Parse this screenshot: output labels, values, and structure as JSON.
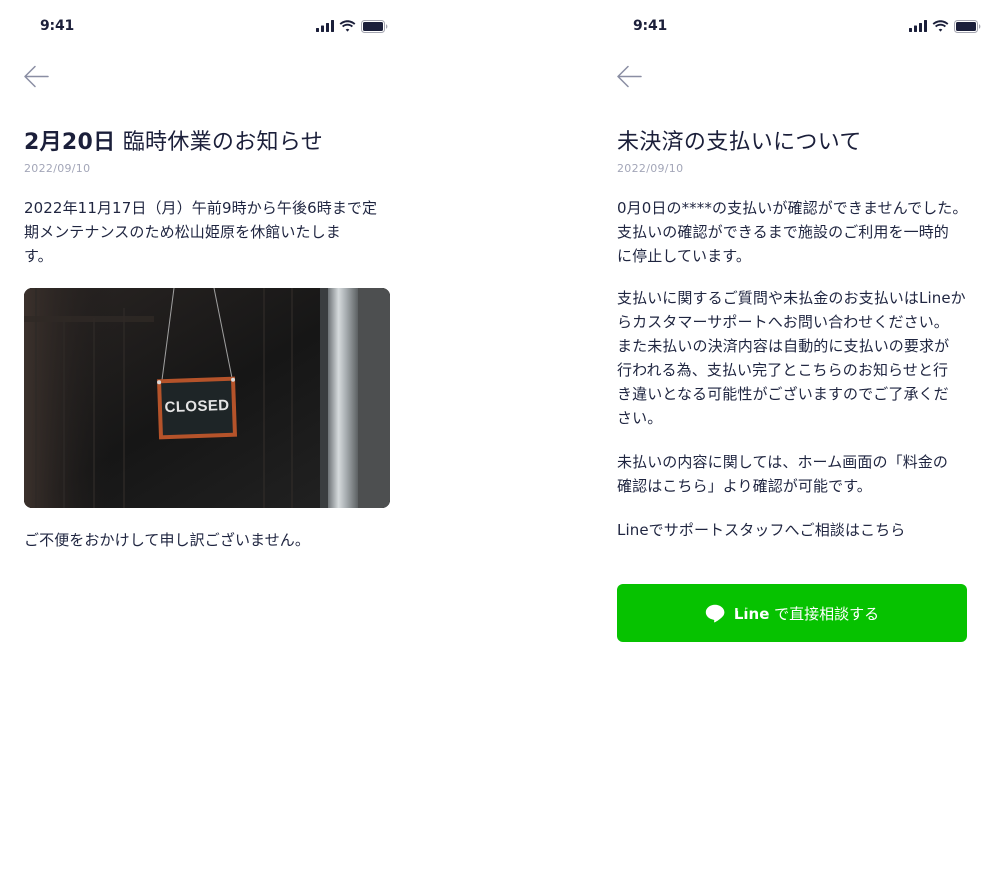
{
  "status_bar": {
    "time": "9:41"
  },
  "notice": {
    "title_num": "2月20日",
    "title_rest": " 臨時休業のお知らせ",
    "date": "2022/09/10",
    "body_lines": [
      "2022年11月17日（月）午前9時から午後6時まで定",
      "期メンテナンスのため松山姫原を休館いたしま",
      "す。"
    ],
    "photo_sign_text": "CLOSED",
    "footer_text": "ご不便をおかけして申し訳ございません。"
  },
  "payment": {
    "title": "未決済の支払いについて",
    "date": "2022/09/10",
    "paragraph1_lines": [
      "0月0日の****の支払いが確認ができませんでした。",
      "支払いの確認ができるまで施設のご利用を一時的",
      "に停止しています。"
    ],
    "paragraph2_lines": [
      "支払いに関するご質問や未払金のお支払いはLineか",
      "らカスタマーサポートへお問い合わせください。",
      "また未払いの決済内容は自動的に支払いの要求が",
      "行われる為、支払い完了とこちらのお知らせと行",
      "き違いとなる可能性がございますのでご了承くだ",
      "さい。"
    ],
    "paragraph3_lines": [
      "未払いの内容に関しては、ホーム画面の「料金の",
      "確認はこちら」より確認が可能です。"
    ],
    "paragraph4": "Lineでサポートスタッフへご相談はこちら",
    "button": {
      "icon_text": "LINE",
      "label_strong": "Line",
      "label_rest": " で直接相談する"
    }
  },
  "colors": {
    "line_green": "#06c200",
    "text": "#1f2540",
    "date_gray": "#a3a6b8",
    "sign_border": "#b5532a"
  }
}
